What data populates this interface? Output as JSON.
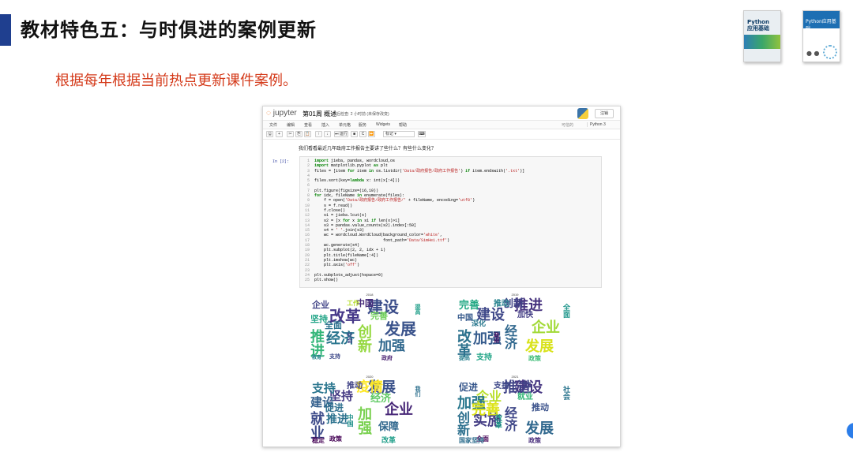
{
  "slide": {
    "title": "教材特色五：与时俱进的案例更新",
    "subtitle": "根据每年根据当前热点更新课件案例。"
  },
  "colors": {
    "title_accent": "#1f3f8f",
    "subtitle": "#d43a1a"
  },
  "covers": {
    "book1_title": "Python\n应用基础",
    "book2_title": "Python应用基础"
  },
  "notebook": {
    "logo_text": "jupyter",
    "notebook_name": "第01周 概述",
    "save_status": "最后检查: 2 小时前 (未保存改变)",
    "logout_label": "注销",
    "menu": [
      "文件",
      "编辑",
      "查看",
      "插入",
      "单元格",
      "服务",
      "Widgets",
      "帮助"
    ],
    "trusted": "可信的",
    "kernel": "Python 3",
    "toolbar": {
      "save": "🖫",
      "add": "+",
      "cut": "✂",
      "copy": "⎘",
      "paste": "📋",
      "up": "↑",
      "down": "↓",
      "run": "⏭ 运行",
      "stop": "■",
      "restart": "C",
      "restart_run": "⏩",
      "cell_type": "标记",
      "keyboard": "⌨"
    },
    "markdown_text": "我们看看最近几年政府工作报告主要讲了些什么？有些什么变化？",
    "prompt": "In [2]:",
    "code_lines": [
      "import jieba, pandas, wordcloud,os",
      "import matplotlib.pyplot as plt",
      "files = [item for item in os.listdir('Data/政府报告/政府工作报告') if item.endswith('.txt')]",
      "",
      "files.sort(key=lambda x: int(x[:4]))",
      "",
      "plt.figure(figsize=(16,10))",
      "for idx, fileName in enumerate(files):",
      "    f = open('Data/政府报告/政府工作报告/' + fileName, encoding='utf8')",
      "    s = f.read()",
      "    f.close()",
      "    s1 = jieba.lcut(s)",
      "    s2 = [x for x in s1 if len(x)>1]",
      "    s3 = pandas.value_counts(s2).index[:50]",
      "    s4 = ' '.join(s3)",
      "    wc = wordcloud.WordCloud(background_color='white',",
      "                             font_path='Data/SimHei.ttf')",
      "    wc.generate(s4)",
      "    plt.subplot(2, 2, idx + 1)",
      "    plt.title(fileName[:4])",
      "    plt.imshow(wc)",
      "    plt.axis('off')",
      "",
      "plt.subplots_adjust(hspace=0)",
      "plt.show()"
    ],
    "clouds": [
      {
        "year": "2018",
        "words": [
          {
            "t": "建设",
            "c": "#3b4d8a",
            "s": 20
          },
          {
            "t": "改革",
            "c": "#453788",
            "s": 20
          },
          {
            "t": "创新",
            "c": "#95d840",
            "s": 18
          },
          {
            "t": "发展",
            "c": "#3a538b",
            "s": 20
          },
          {
            "t": "经济",
            "c": "#2a768e",
            "s": 18
          },
          {
            "t": "推进",
            "c": "#34b679",
            "s": 18
          },
          {
            "t": "加强",
            "c": "#31688e",
            "s": 17
          },
          {
            "t": "中国",
            "c": "#472c7a",
            "s": 11
          },
          {
            "t": "企业",
            "c": "#414487",
            "s": 11
          },
          {
            "t": "坚持",
            "c": "#20a486",
            "s": 11
          },
          {
            "t": "全面",
            "c": "#2c728e",
            "s": 11
          },
          {
            "t": "完善",
            "c": "#6ece58",
            "s": 11
          },
          {
            "t": "工作",
            "c": "#b5de2b",
            "s": 8
          },
          {
            "t": "支持",
            "c": "#3e4989",
            "s": 7
          },
          {
            "t": "政府",
            "c": "#481f70",
            "s": 7
          },
          {
            "t": "提高",
            "c": "#1f9e89",
            "s": 7
          },
          {
            "t": "社会",
            "c": "#404688",
            "s": 7
          },
          {
            "t": "教育",
            "c": "#25848e",
            "s": 6
          }
        ]
      },
      {
        "year": "2019",
        "words": [
          {
            "t": "推进",
            "c": "#46327e",
            "s": 18
          },
          {
            "t": "建设",
            "c": "#3f4889",
            "s": 18
          },
          {
            "t": "经济",
            "c": "#31688e",
            "s": 16
          },
          {
            "t": "企业",
            "c": "#a2da37",
            "s": 18
          },
          {
            "t": "加强",
            "c": "#365c8d",
            "s": 18
          },
          {
            "t": "改革",
            "c": "#2c728e",
            "s": 18
          },
          {
            "t": "发展",
            "c": "#d8e219",
            "s": 18
          },
          {
            "t": "创新",
            "c": "#414487",
            "s": 13
          },
          {
            "t": "完善",
            "c": "#22a884",
            "s": 13
          },
          {
            "t": "中国",
            "c": "#375b8d",
            "s": 10
          },
          {
            "t": "深化",
            "c": "#2a788e",
            "s": 9
          },
          {
            "t": "加快",
            "c": "#433e85",
            "s": 10
          },
          {
            "t": "推动",
            "c": "#26828e",
            "s": 10
          },
          {
            "t": "支持",
            "c": "#20a486",
            "s": 10
          },
          {
            "t": "政策",
            "c": "#3bbb75",
            "s": 8
          },
          {
            "t": "全面",
            "c": "#1f968b",
            "s": 9
          },
          {
            "t": "政府",
            "c": "#46085c",
            "s": 7
          },
          {
            "t": "提高",
            "c": "#277f8e",
            "s": 7
          }
        ]
      },
      {
        "year": "2020",
        "words": [
          {
            "t": "发展",
            "c": "#3b528b",
            "s": 18
          },
          {
            "t": "坚持",
            "c": "#443983",
            "s": 15
          },
          {
            "t": "加强",
            "c": "#7ad151",
            "s": 18
          },
          {
            "t": "企业",
            "c": "#482878",
            "s": 18
          },
          {
            "t": "推进",
            "c": "#2c728e",
            "s": 14
          },
          {
            "t": "就业",
            "c": "#3e4c8a",
            "s": 18
          },
          {
            "t": "保障",
            "c": "#31688e",
            "s": 13
          },
          {
            "t": "疫情",
            "c": "#fde725",
            "s": 17
          },
          {
            "t": "支持",
            "c": "#2a768e",
            "s": 15
          },
          {
            "t": "建设",
            "c": "#34608d",
            "s": 15
          },
          {
            "t": "促进",
            "c": "#2e6f8e",
            "s": 12
          },
          {
            "t": "经济",
            "c": "#5ec962",
            "s": 13
          },
          {
            "t": "推动",
            "c": "#414487",
            "s": 10
          },
          {
            "t": "政策",
            "c": "#440154",
            "s": 8
          },
          {
            "t": "改革",
            "c": "#1f9e89",
            "s": 9
          },
          {
            "t": "我们",
            "c": "#2d708e",
            "s": 7
          },
          {
            "t": "中国",
            "c": "#21918c",
            "s": 8
          },
          {
            "t": "稳定",
            "c": "#440154",
            "s": 8
          }
        ]
      },
      {
        "year": "2021",
        "words": [
          {
            "t": "建设",
            "c": "#453581",
            "s": 18
          },
          {
            "t": "企业",
            "c": "#b8de29",
            "s": 16
          },
          {
            "t": "经济",
            "c": "#3f4788",
            "s": 16
          },
          {
            "t": "推动",
            "c": "#3b528b",
            "s": 11
          },
          {
            "t": "实施",
            "c": "#433d84",
            "s": 18
          },
          {
            "t": "创新",
            "c": "#2d708e",
            "s": 16
          },
          {
            "t": "发展",
            "c": "#31688e",
            "s": 18
          },
          {
            "t": "推进",
            "c": "#404387",
            "s": 18
          },
          {
            "t": "促进",
            "c": "#38588c",
            "s": 12
          },
          {
            "t": "加强",
            "c": "#2a788e",
            "s": 18
          },
          {
            "t": "完善",
            "c": "#dde318",
            "s": 18
          },
          {
            "t": "就业",
            "c": "#35b779",
            "s": 10
          },
          {
            "t": "支持",
            "c": "#3e4989",
            "s": 10
          },
          {
            "t": "全面",
            "c": "#440154",
            "s": 8
          },
          {
            "t": "政策",
            "c": "#472d7b",
            "s": 8
          },
          {
            "t": "社会",
            "c": "#2b758e",
            "s": 9
          },
          {
            "t": "改革",
            "c": "#1f9e89",
            "s": 9
          },
          {
            "t": "国家坚持",
            "c": "#2e6e8e",
            "s": 8
          }
        ]
      }
    ]
  }
}
